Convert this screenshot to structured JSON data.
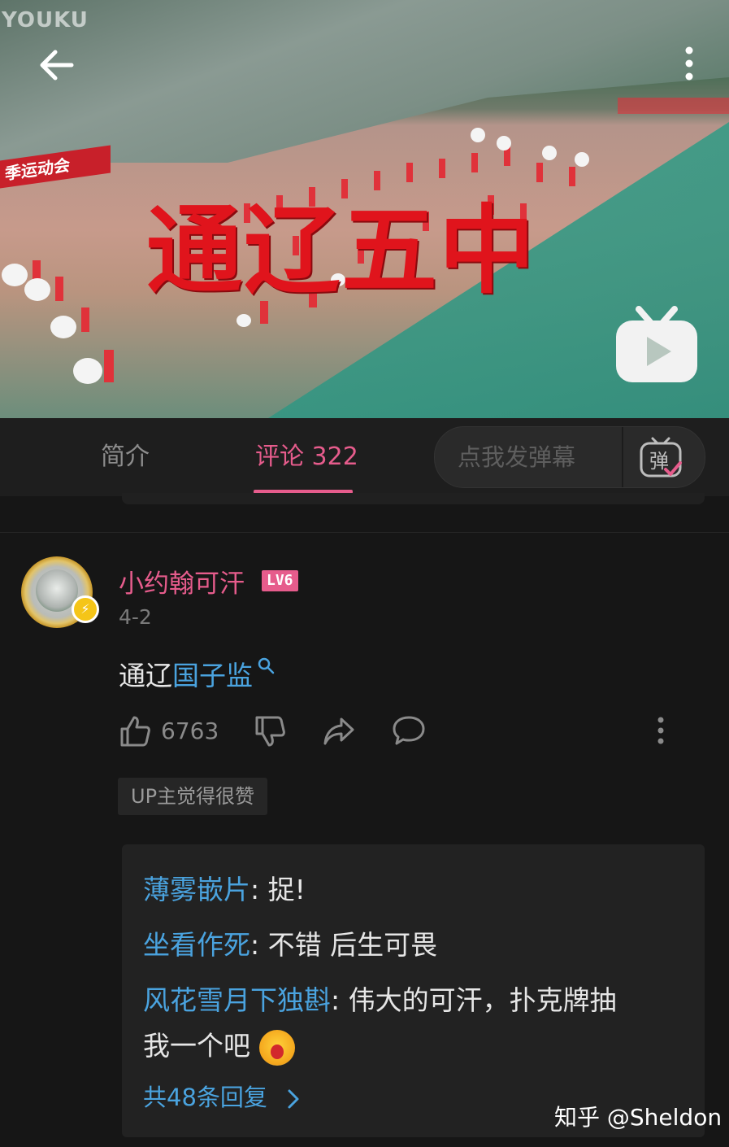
{
  "video": {
    "watermark": "YOUKU",
    "banner_text": "季运动会",
    "overlay_text": "通辽五中"
  },
  "tabs": {
    "intro_label": "简介",
    "comments_label": "评论 322",
    "danmaku_placeholder": "点我发弹幕",
    "danmaku_button_glyph": "弹"
  },
  "comment": {
    "username": "小约翰可汗",
    "level": "LV6",
    "date": "4-2",
    "text_prefix": "通辽",
    "text_link": "国子监",
    "like_count": "6763",
    "up_badge": "UP主觉得很赞"
  },
  "replies": [
    {
      "user": "薄雾嵌片",
      "sep": ": ",
      "text": "捉!"
    },
    {
      "user": "坐看作死",
      "sep": ": ",
      "text": "不错 后生可畏"
    },
    {
      "user": "风花雪月下独斟",
      "sep": ": ",
      "text": "伟大的可汗，扑克牌抽",
      "text2": "我一个吧"
    }
  ],
  "more_replies": "共48条回复",
  "footer_watermark": "知乎 @Sheldon",
  "colors": {
    "accent_pink": "#e65c8c",
    "link_blue": "#4aa3df",
    "background": "#161616"
  },
  "icons": [
    "back-arrow-icon",
    "more-vertical-icon",
    "bilibili-tv-icon",
    "danmaku-icon",
    "search-icon",
    "thumbs-up-icon",
    "thumbs-down-icon",
    "share-icon",
    "reply-icon",
    "chevron-right-icon",
    "crying-emoji-icon"
  ]
}
